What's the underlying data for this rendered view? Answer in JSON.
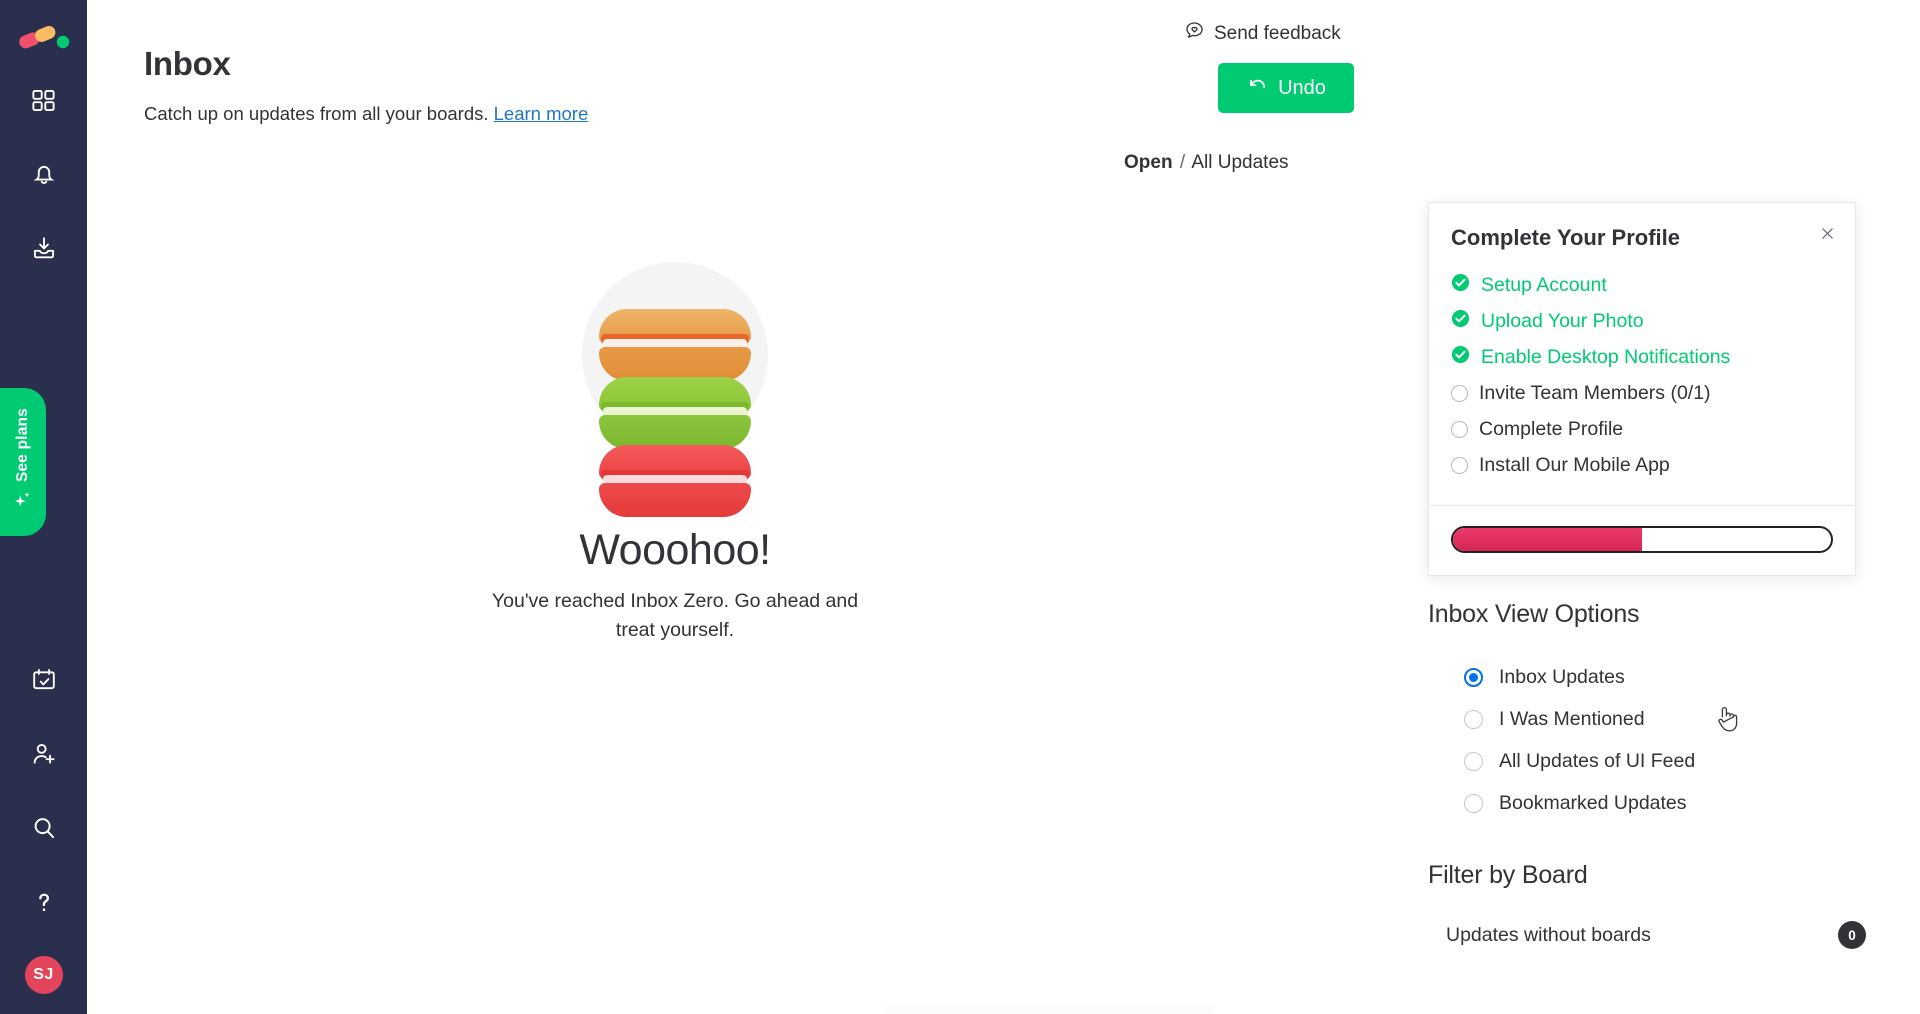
{
  "sidebar": {
    "logo_name": "monday-logo",
    "logo_colors": {
      "red": "#f04f6d",
      "yellow": "#fdbc64",
      "green": "#00ca72"
    },
    "top_items": [
      {
        "name": "home-grid-icon",
        "label": "Home"
      },
      {
        "name": "bell-notifications-icon",
        "label": "Notifications"
      },
      {
        "name": "inbox-tray-icon",
        "label": "Inbox"
      }
    ],
    "see_plans": {
      "label": "See plans",
      "color": "#00ca72",
      "icon": "sparkles-icon"
    },
    "bottom_items": [
      {
        "name": "calendar-check-icon",
        "label": "My work"
      },
      {
        "name": "invite-member-icon",
        "label": "Invite members"
      },
      {
        "name": "search-icon",
        "label": "Search"
      },
      {
        "name": "help-question-icon",
        "label": "Help"
      }
    ],
    "avatar": {
      "initials": "SJ",
      "color": "#e2445c"
    }
  },
  "header": {
    "title": "Inbox",
    "subtitle": "Catch up on updates from all your boards.",
    "learn_more": "Learn more",
    "send_feedback": "Send feedback",
    "feedback_icon": "heart-speech-bubble-icon",
    "undo_label": "Undo",
    "undo_icon": "undo-arrow-icon",
    "undo_color": "#00ca72"
  },
  "breadcrumb": {
    "current": "Open",
    "separator": "/",
    "parent": "All Updates"
  },
  "empty_state": {
    "illustration": "stacked-macarons-illustration",
    "macarons": [
      {
        "name": "orange-macaron",
        "shell": "#e9a051",
        "ruffle": "#e8622a"
      },
      {
        "name": "green-macaron",
        "shell": "#8cc63e",
        "ruffle": "#7ab828"
      },
      {
        "name": "red-macaron",
        "shell": "#ef4d4d",
        "ruffle": "#e53535"
      }
    ],
    "title": "Wooohoo!",
    "message": "You've reached Inbox Zero. Go ahead and treat yourself."
  },
  "profile_card": {
    "title": "Complete Your Profile",
    "close_icon": "close-icon",
    "items": [
      {
        "label": "Setup Account",
        "done": true
      },
      {
        "label": "Upload Your Photo",
        "done": true
      },
      {
        "label": "Enable Desktop Notifications",
        "done": true
      },
      {
        "label": "Invite Team Members (0/1)",
        "done": false
      },
      {
        "label": "Complete Profile",
        "done": false
      },
      {
        "label": "Install Our Mobile App",
        "done": false
      }
    ],
    "progress_percent": 50,
    "progress_color": "#e0366a",
    "done_color": "#00ca72"
  },
  "view_options": {
    "title": "Inbox View Options",
    "selected": "Inbox Updates",
    "accent": "#0073ea",
    "options": [
      {
        "label": "Inbox Updates",
        "selected": true
      },
      {
        "label": "I Was Mentioned",
        "selected": false
      },
      {
        "label": "All Updates of UI Feed",
        "selected": false
      },
      {
        "label": "Bookmarked Updates",
        "selected": false
      }
    ]
  },
  "filter_by_board": {
    "title": "Filter by Board",
    "rows": [
      {
        "name": "Updates without boards",
        "count": "0"
      }
    ]
  },
  "cursor": {
    "type": "pointer-hand-cursor"
  }
}
